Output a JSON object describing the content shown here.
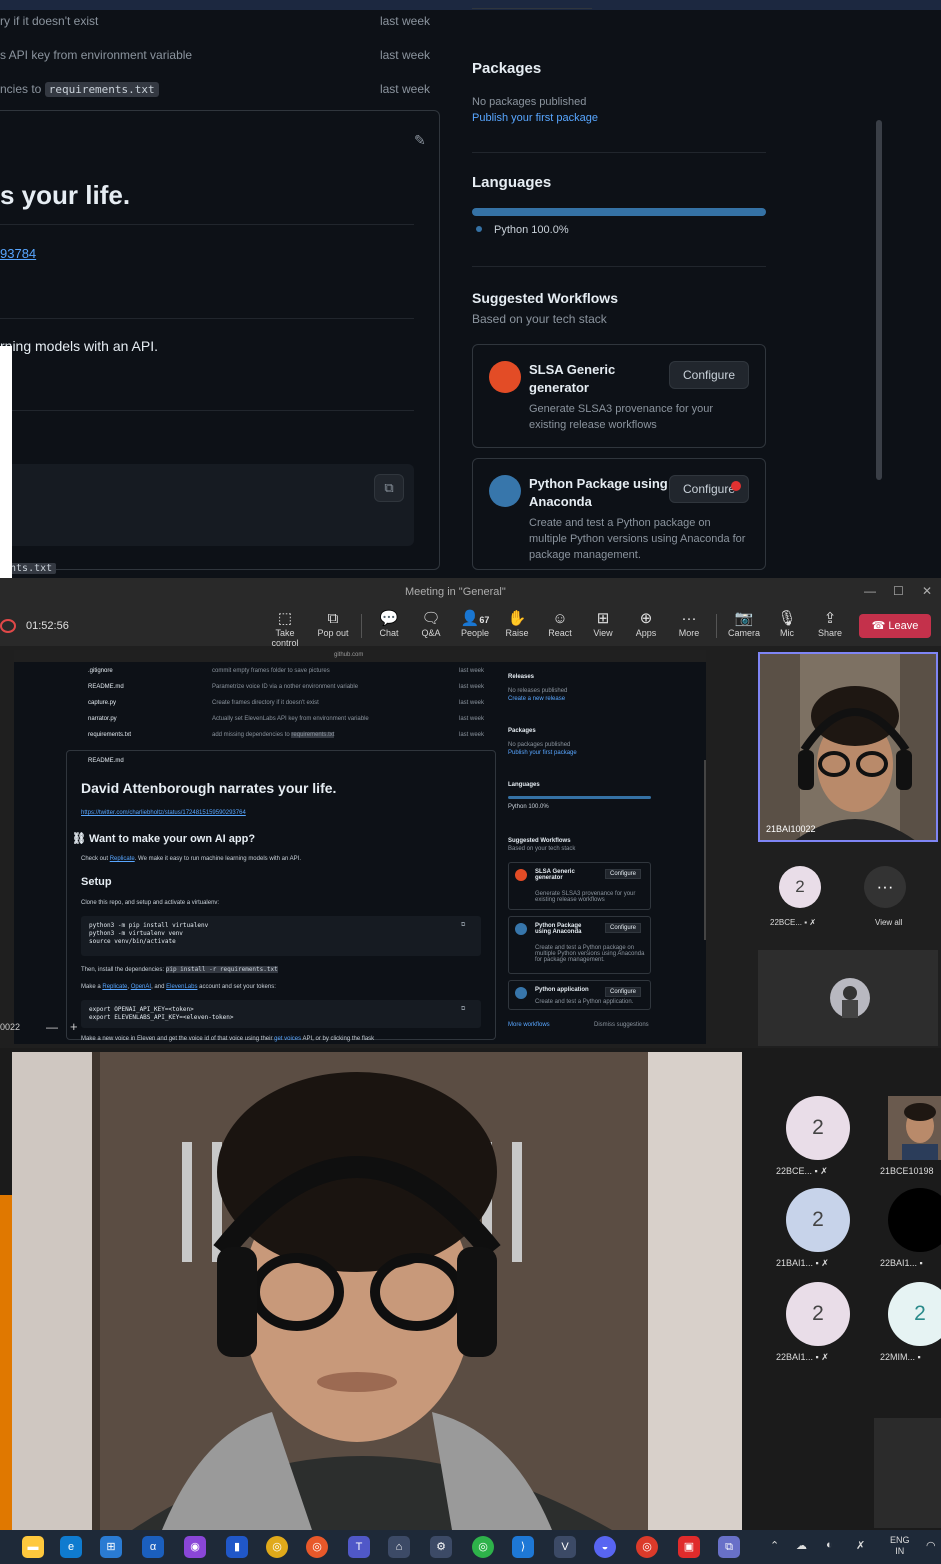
{
  "github_zoom": {
    "files": [
      {
        "msg": "ry if it doesn't exist",
        "when": "last week"
      },
      {
        "msg": "s API key from environment variable",
        "when": "last week"
      },
      {
        "msg": "ncies to",
        "code": "requirements.txt",
        "when": "last week"
      }
    ],
    "readme_title": "s your life.",
    "readme_link": "93784",
    "readme_text": "rning models with an API.",
    "code_fragment": "ents.txt",
    "packages_heading": "Packages",
    "packages_none": "No packages published",
    "packages_link": "Publish your first package",
    "languages_heading": "Languages",
    "language_item": "Python 100.0%",
    "workflows_heading": "Suggested Workflows",
    "workflows_sub": "Based on your tech stack",
    "workflows": [
      {
        "title": "SLSA Generic generator",
        "desc": "Generate SLSA3 provenance for your existing release workflows",
        "button": "Configure"
      },
      {
        "title": "Python Package using Anaconda",
        "desc": "Create and test a Python package on multiple Python versions using Anaconda for package management.",
        "button": "Configure"
      }
    ],
    "colors": {
      "bg": "#0d1117",
      "link": "#58a6ff",
      "python": "#3572a5"
    }
  },
  "teams": {
    "window_title": "Meeting in \"General\"",
    "timer": "01:52:56",
    "toolbar": [
      {
        "label": "Take control",
        "icon": "take-control-icon"
      },
      {
        "label": "Pop out",
        "icon": "pop-out-icon"
      },
      {
        "label": "Chat",
        "icon": "chat-icon"
      },
      {
        "label": "Q&A",
        "icon": "qa-icon"
      },
      {
        "label": "People",
        "icon": "people-icon"
      },
      {
        "label": "Raise",
        "icon": "raise-hand-icon"
      },
      {
        "label": "React",
        "icon": "react-icon"
      },
      {
        "label": "View",
        "icon": "view-icon"
      },
      {
        "label": "Apps",
        "icon": "apps-icon"
      },
      {
        "label": "More",
        "icon": "more-icon"
      },
      {
        "label": "Camera",
        "icon": "camera-off-icon"
      },
      {
        "label": "Mic",
        "icon": "mic-off-icon"
      },
      {
        "label": "Share",
        "icon": "share-icon"
      }
    ],
    "people_count": "67",
    "leave_label": "Leave",
    "shared_screen": {
      "url": "github.com",
      "files": [
        {
          "name": ".gitignore",
          "msg": "commit empty frames folder to save pictures",
          "when": "last week"
        },
        {
          "name": "README.md",
          "msg": "Parametrize voice ID via a nother environment variable",
          "when": "last week"
        },
        {
          "name": "capture.py",
          "msg": "Create frames directory if it doesn't exist",
          "when": "last week"
        },
        {
          "name": "narrator.py",
          "msg": "Actually set ElevenLabs API key from environment variable",
          "when": "last week"
        },
        {
          "name": "requirements.txt",
          "msg": "add missing dependencies to",
          "code": "requirements.txt",
          "when": "last week"
        }
      ],
      "readme_label": "README.md",
      "title": "David Attenborough narrates your life.",
      "link": "https://twitter.com/charliebholtz/status/1724815159590293764",
      "h2_app": "Want to make your own AI app?",
      "checkout_pre": "Check out",
      "checkout_link": "Replicate",
      "checkout_post": ". We make it easy to run machine learning models with an API.",
      "setup": "Setup",
      "clone": "Clone this repo, and setup and activate a virtualenv:",
      "code1": [
        "python3 -m pip install virtualenv",
        "python3 -m virtualenv venv",
        "source venv/bin/activate"
      ],
      "install_pre": "Then, install the dependencies:",
      "install_code": "pip install -r requirements.txt",
      "make_pre": "Make a",
      "make_l1": "Replicate",
      "make_l2": "OpenAI",
      "make_and": ", and",
      "make_l3": "ElevenLabs",
      "make_post": "account and set your tokens:",
      "code2": [
        "export OPENAI_API_KEY=<token>",
        "export ELEVENLABS_API_KEY=<eleven-token>"
      ],
      "last_line_pre": "Make a new voice in Eleven and get the voice id of that voice using their",
      "last_line_link": "get voices",
      "last_line_post": "API, or by clicking the flask",
      "releases": "Releases",
      "releases_none": "No releases published",
      "releases_link": "Create a new release",
      "packages": "Packages",
      "packages_none": "No packages published",
      "packages_link": "Publish your first package",
      "languages": "Languages",
      "language_item": "Python 100.0%",
      "workflows": "Suggested Workflows",
      "workflows_sub": "Based on your tech stack",
      "wf": [
        {
          "title": "SLSA Generic generator",
          "desc": "Generate SLSA3 provenance for your existing release workflows",
          "button": "Configure"
        },
        {
          "title": "Python Package using Anaconda",
          "desc": "Create and test a Python package on multiple Python versions using Anaconda for package management.",
          "button": "Configure"
        },
        {
          "title": "Python application",
          "desc": "Create and test a Python application.",
          "button": "Configure"
        }
      ],
      "more_workflows": "More workflows",
      "dismiss": "Dismiss suggestions",
      "left_id": "0022"
    },
    "self_tile_name": "21BAI10022",
    "strip": [
      {
        "initial": "2",
        "name": "22BCE..."
      },
      {
        "label": "View all"
      }
    ]
  },
  "participants": [
    {
      "initial": "2",
      "name": "22BCE...",
      "color": "#e9dde8"
    },
    {
      "initial": "",
      "name": "21BCE10198",
      "color": "#6a5a4e"
    },
    {
      "initial": "2",
      "name": "21BAI1...",
      "color": "#c7d3ea"
    },
    {
      "initial": "",
      "name": "22BAI1...",
      "color": "#000000"
    },
    {
      "initial": "2",
      "name": "22BAI1...",
      "color": "#e9dde8"
    },
    {
      "initial": "2",
      "name": "22MIM...",
      "color": "#e6f3f3"
    }
  ],
  "taskbar": {
    "lang_top": "ENG",
    "lang_bottom": "IN"
  }
}
